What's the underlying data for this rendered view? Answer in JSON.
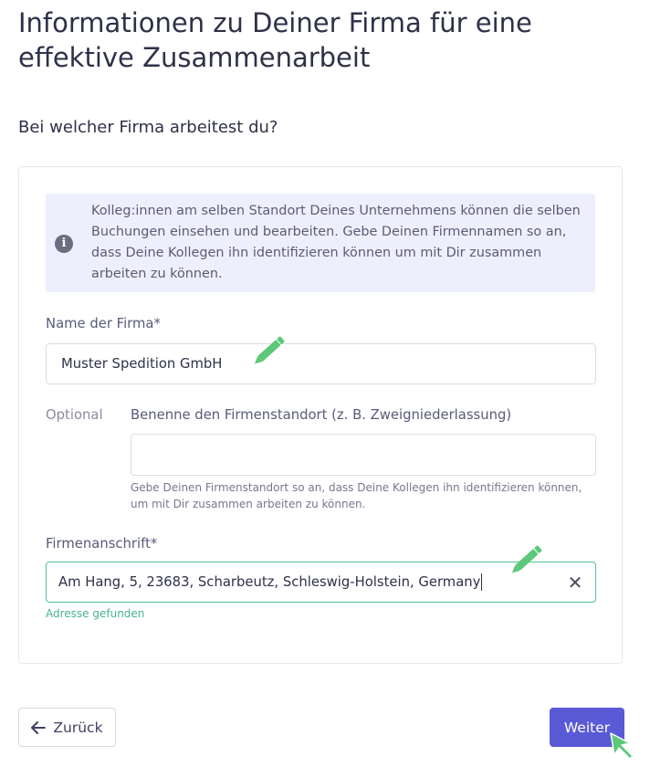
{
  "page": {
    "title": "Informationen zu Deiner Firma für eine effektive Zusammenarbeit",
    "section_title": "Bei welcher Firma arbeitest du?"
  },
  "info": {
    "icon": "info-icon",
    "text": "Kolleg:innen am selben Standort Deines Unternehmens können die selben Buchungen einsehen und bearbeiten. Gebe Deinen Firmennamen so an, dass Deine Kollegen ihn identifizieren können um mit Dir zusammen arbeiten zu können."
  },
  "form": {
    "company": {
      "label": "Name der Firma*",
      "value": "Muster Spedition GmbH"
    },
    "location": {
      "optional_label": "Optional",
      "label": "Benenne den Firmenstandort (z. B. Zweigniederlassung)",
      "value": "",
      "hint": "Gebe Deinen Firmenstandort so an, dass Deine Kollegen ihn identifizieren können, um mit Dir zusammen arbeiten zu können."
    },
    "address": {
      "label": "Firmenanschrift*",
      "value": "Am Hang, 5, 23683, Scharbeutz, Schleswig-Holstein, Germany",
      "status": "Adresse gefunden",
      "clear_icon": "close-icon"
    }
  },
  "nav": {
    "back_label": "Zurück",
    "back_icon": "arrow-left-icon",
    "next_label": "Weiter"
  },
  "annotations": {
    "edit_icon": "pencil-icon",
    "cursor_icon": "mouse-pointer-icon",
    "color": "#5bc87a"
  },
  "colors": {
    "primary": "#5a5ad6",
    "success": "#46b58e",
    "info_bg": "#eeeffd"
  }
}
